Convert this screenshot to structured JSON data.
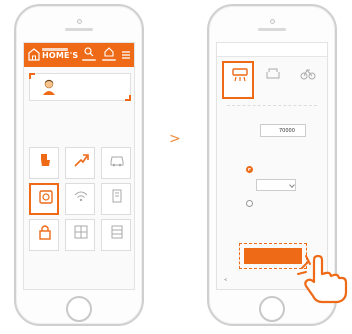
{
  "left_screen": {
    "logo_text": "HOME'S",
    "logo_tagline": "",
    "header_icons": [
      {
        "name": "search-icon",
        "label": ""
      },
      {
        "name": "favorite-icon",
        "label": ""
      }
    ],
    "hero_title": "",
    "step_text": "",
    "instruction": "",
    "tiles": [
      {
        "name": "bath-toilet-icon",
        "label": "",
        "active": false
      },
      {
        "name": "trend-icon",
        "label": "",
        "active": false
      },
      {
        "name": "car-icon",
        "label": "",
        "active": false
      },
      {
        "name": "appliance-icon",
        "label": "",
        "active": true
      },
      {
        "name": "wifi-icon",
        "label": "",
        "active": false
      },
      {
        "name": "building-icon",
        "label": "",
        "active": false
      },
      {
        "name": "lock-icon",
        "label": "",
        "active": false
      },
      {
        "name": "grid-icon",
        "label": "",
        "active": false
      },
      {
        "name": "bookshelf-icon",
        "label": "",
        "active": false
      }
    ]
  },
  "arrow_label": ">",
  "right_screen": {
    "tabs": [
      "",
      "",
      ""
    ],
    "features": [
      {
        "name": "air-conditioner-icon",
        "label": "",
        "selected": true
      },
      {
        "name": "sofa-icon",
        "label": "",
        "selected": false
      },
      {
        "name": "bicycle-icon",
        "label": "",
        "selected": false
      }
    ],
    "section_title": "",
    "rent": {
      "tag": "",
      "label": "",
      "value": "70000",
      "unit": "",
      "sub_label": ""
    },
    "option": {
      "tag": "",
      "choices": [
        {
          "label": "",
          "selected": true
        },
        {
          "label": "",
          "selected": false
        }
      ],
      "select_value": ""
    },
    "cta_label": "",
    "back_label": "<"
  },
  "colors": {
    "accent": "#ee6a17",
    "border": "#cfcfcf"
  }
}
